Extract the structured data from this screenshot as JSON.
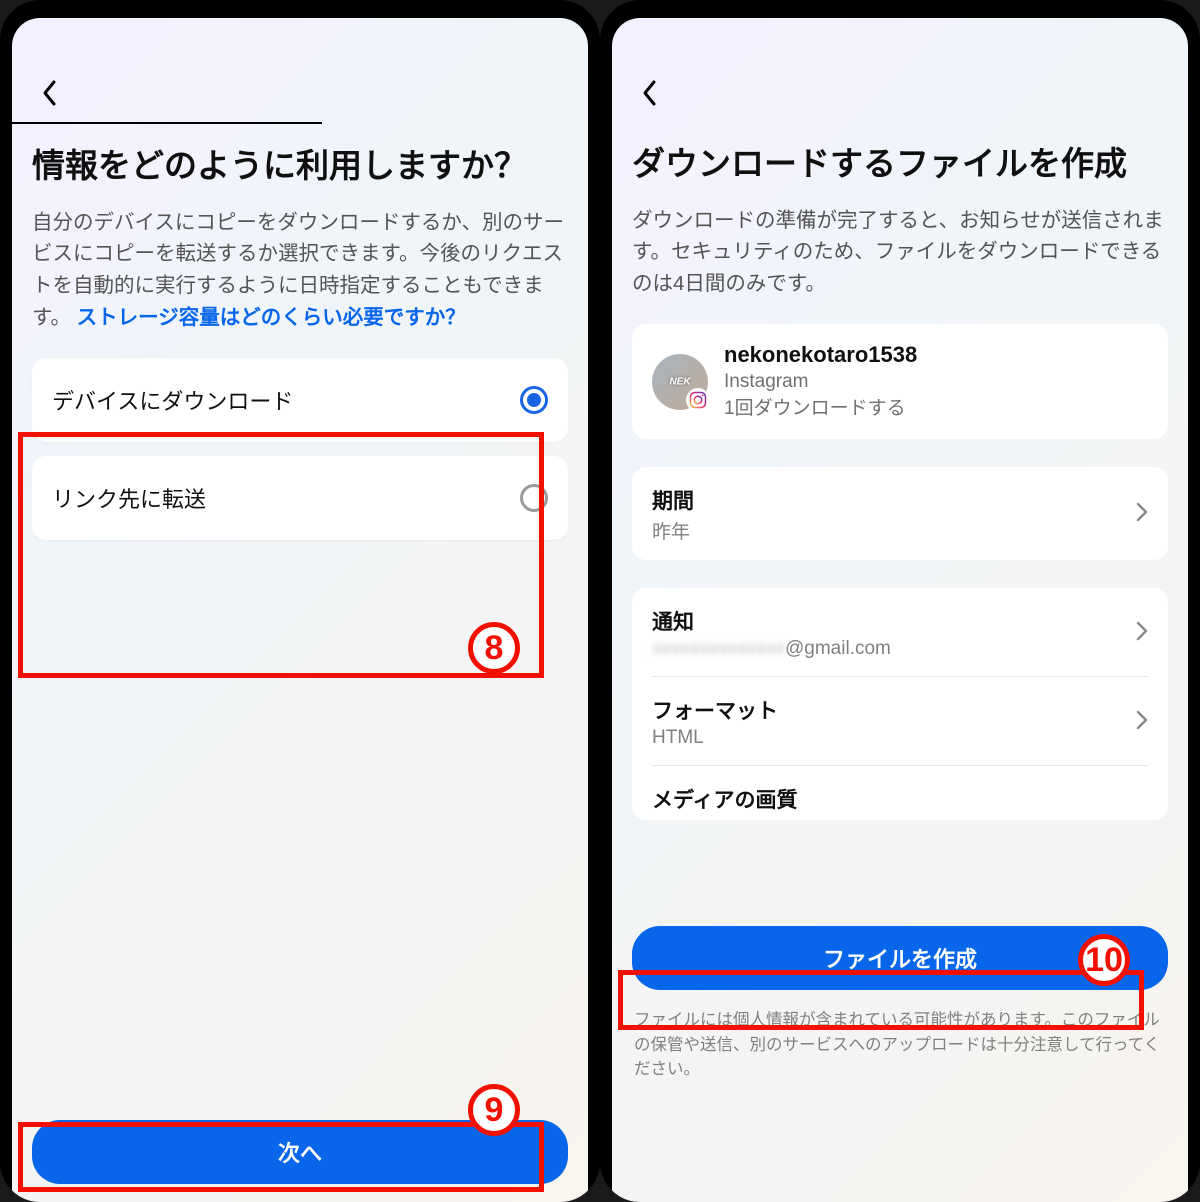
{
  "left": {
    "title": "情報をどのように利用しますか？",
    "description": "自分のデバイスにコピーをダウンロードするか、別のサービスにコピーを転送するか選択できます。今後のリクエストを自動的に実行するように日時指定することもできます。 ",
    "link": "ストレージ容量はどのくらい必要ですか？",
    "option1": "デバイスにダウンロード",
    "option2": "リンク先に転送",
    "next_button": "次へ"
  },
  "right": {
    "title": "ダウンロードするファイルを作成",
    "description": "ダウンロードの準備が完了すると、お知らせが送信されます。セキュリティのため、ファイルをダウンロードできるのは4日間のみです。",
    "account": {
      "name": "nekonekotaro1538",
      "platform": "Instagram",
      "download_note": "1回ダウンロードする"
    },
    "settings": {
      "period_label": "期間",
      "period_value": "昨年",
      "notify_label": "通知",
      "notify_value_suffix": "@gmail.com",
      "format_label": "フォーマット",
      "format_value": "HTML",
      "media_label": "メディアの画質"
    },
    "create_button": "ファイルを作成",
    "disclaimer": "ファイルには個人情報が含まれている可能性があります。このファイルの保管や送信、別のサービスへのアップロードは十分注意して行ってください。"
  },
  "annotations": {
    "step8": "8",
    "step9": "9",
    "step10": "10"
  }
}
